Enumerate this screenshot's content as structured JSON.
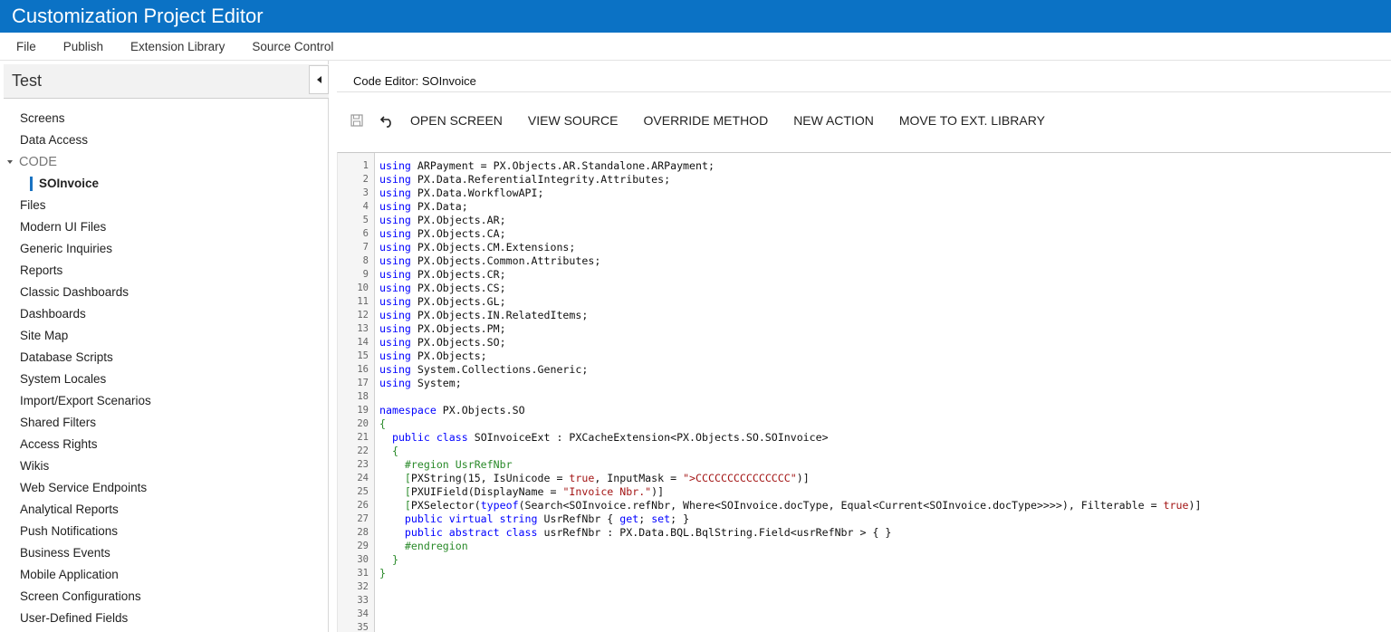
{
  "app": {
    "title": "Customization Project Editor"
  },
  "menu": [
    "File",
    "Publish",
    "Extension Library",
    "Source Control"
  ],
  "project": {
    "name": "Test"
  },
  "nav": {
    "items_top": [
      "Screens",
      "Data Access"
    ],
    "group_label": "CODE",
    "active_sub": "SOInvoice",
    "items_bottom": [
      "Files",
      "Modern UI Files",
      "Generic Inquiries",
      "Reports",
      "Classic Dashboards",
      "Dashboards",
      "Site Map",
      "Database Scripts",
      "System Locales",
      "Import/Export Scenarios",
      "Shared Filters",
      "Access Rights",
      "Wikis",
      "Web Service Endpoints",
      "Analytical Reports",
      "Push Notifications",
      "Business Events",
      "Mobile Application",
      "Screen Configurations",
      "User-Defined Fields"
    ]
  },
  "editor": {
    "title": "Code Editor: SOInvoice",
    "toolbar": {
      "save_icon": "save-icon",
      "undo_icon": "undo-icon",
      "buttons": [
        "OPEN SCREEN",
        "VIEW SOURCE",
        "OVERRIDE METHOD",
        "NEW ACTION",
        "MOVE TO EXT. LIBRARY"
      ]
    },
    "line_numbers": [
      "1",
      "2",
      "3",
      "4",
      "5",
      "6",
      "7",
      "8",
      "9",
      "10",
      "11",
      "12",
      "13",
      "14",
      "15",
      "16",
      "17",
      "18",
      "19",
      "20",
      "21",
      "22",
      "23",
      "24",
      "25",
      "26",
      "27",
      "28",
      "29",
      "30",
      "31",
      "32",
      "33",
      "34",
      "35"
    ],
    "code_lines": [
      [
        [
          "kw",
          "using"
        ],
        [
          "t",
          " ARPayment = PX.Objects.AR.Standalone.ARPayment;"
        ]
      ],
      [
        [
          "kw",
          "using"
        ],
        [
          "t",
          " PX.Data.ReferentialIntegrity.Attributes;"
        ]
      ],
      [
        [
          "kw",
          "using"
        ],
        [
          "t",
          " PX.Data.WorkflowAPI;"
        ]
      ],
      [
        [
          "kw",
          "using"
        ],
        [
          "t",
          " PX.Data;"
        ]
      ],
      [
        [
          "kw",
          "using"
        ],
        [
          "t",
          " PX.Objects.AR;"
        ]
      ],
      [
        [
          "kw",
          "using"
        ],
        [
          "t",
          " PX.Objects.CA;"
        ]
      ],
      [
        [
          "kw",
          "using"
        ],
        [
          "t",
          " PX.Objects.CM.Extensions;"
        ]
      ],
      [
        [
          "kw",
          "using"
        ],
        [
          "t",
          " PX.Objects.Common.Attributes;"
        ]
      ],
      [
        [
          "kw",
          "using"
        ],
        [
          "t",
          " PX.Objects.CR;"
        ]
      ],
      [
        [
          "kw",
          "using"
        ],
        [
          "t",
          " PX.Objects.CS;"
        ]
      ],
      [
        [
          "kw",
          "using"
        ],
        [
          "t",
          " PX.Objects.GL;"
        ]
      ],
      [
        [
          "kw",
          "using"
        ],
        [
          "t",
          " PX.Objects.IN.RelatedItems;"
        ]
      ],
      [
        [
          "kw",
          "using"
        ],
        [
          "t",
          " PX.Objects.PM;"
        ]
      ],
      [
        [
          "kw",
          "using"
        ],
        [
          "t",
          " PX.Objects.SO;"
        ]
      ],
      [
        [
          "kw",
          "using"
        ],
        [
          "t",
          " PX.Objects;"
        ]
      ],
      [
        [
          "kw",
          "using"
        ],
        [
          "t",
          " System.Collections.Generic;"
        ]
      ],
      [
        [
          "kw",
          "using"
        ],
        [
          "t",
          " System;"
        ]
      ],
      [],
      [
        [
          "kw",
          "namespace"
        ],
        [
          "t",
          " PX.Objects.SO"
        ]
      ],
      [
        [
          "green",
          "{"
        ]
      ],
      [
        [
          "t",
          "  "
        ],
        [
          "kw",
          "public class"
        ],
        [
          "t",
          " SOInvoiceExt : PXCacheExtension<PX.Objects.SO.SOInvoice>"
        ]
      ],
      [
        [
          "green",
          "  {"
        ]
      ],
      [
        [
          "green",
          "    #region UsrRefNbr"
        ]
      ],
      [
        [
          "green",
          "    ["
        ],
        [
          "t",
          "PXString(15, IsUnicode = "
        ],
        [
          "str",
          "true"
        ],
        [
          "t",
          ", InputMask = "
        ],
        [
          "str",
          "\">CCCCCCCCCCCCCCC\""
        ],
        [
          "t",
          ")]"
        ]
      ],
      [
        [
          "green",
          "    ["
        ],
        [
          "t",
          "PXUIField(DisplayName = "
        ],
        [
          "str",
          "\"Invoice Nbr.\""
        ],
        [
          "t",
          ")]"
        ]
      ],
      [
        [
          "green",
          "    ["
        ],
        [
          "t",
          "PXSelector("
        ],
        [
          "kw",
          "typeof"
        ],
        [
          "t",
          "(Search<SOInvoice.refNbr, Where<SOInvoice.docType, Equal<Current<SOInvoice.docType>>>>), Filterable = "
        ],
        [
          "str",
          "true"
        ],
        [
          "t",
          ")]"
        ]
      ],
      [
        [
          "t",
          "    "
        ],
        [
          "kw",
          "public virtual string"
        ],
        [
          "t",
          " UsrRefNbr { "
        ],
        [
          "kw",
          "get"
        ],
        [
          "t",
          "; "
        ],
        [
          "kw",
          "set"
        ],
        [
          "t",
          "; }"
        ]
      ],
      [
        [
          "t",
          "    "
        ],
        [
          "kw",
          "public abstract class"
        ],
        [
          "t",
          " usrRefNbr : PX.Data.BQL.BqlString.Field<usrRefNbr > { }"
        ]
      ],
      [
        [
          "green",
          "    #endregion"
        ]
      ],
      [
        [
          "green",
          "  }"
        ]
      ],
      [
        [
          "green",
          "}"
        ]
      ],
      [],
      [],
      [],
      []
    ]
  }
}
